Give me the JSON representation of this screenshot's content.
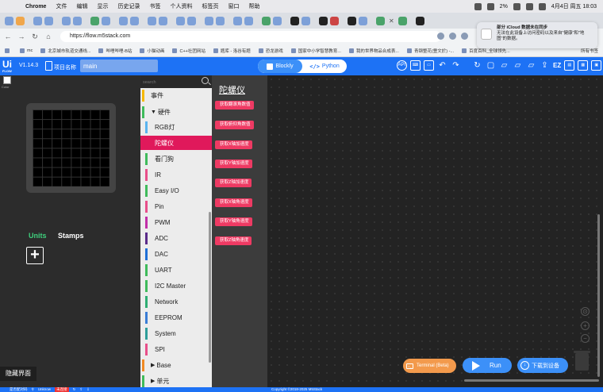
{
  "menubar": {
    "app": "Chrome",
    "items": [
      "文件",
      "编辑",
      "显示",
      "历史记录",
      "书签",
      "个人资料",
      "标签页",
      "窗口",
      "帮助"
    ],
    "battery": "2%",
    "datetime": "4月4日 周五 18:03"
  },
  "browser": {
    "url": "https://flow.m5stack.com",
    "bookmarks": [
      "",
      "mc",
      "北京城市轨道交通线...",
      "哔哩哔哩-B站",
      "小猫动画",
      "C++社团网站",
      "题库 - 洛谷有题",
      "恐龙游戏",
      "国家中小学智慧教育...",
      "我的世界物品合成表...",
      "青钢整花(豊文於) -...",
      "百度百科_全球领先..."
    ],
    "all_bookmarks": "所有书签"
  },
  "notification": {
    "title": "部分 iCloud 数据未在同步",
    "body": "无法在此设备上访问密码以及来自\"健康\"和\"地图\"的数据。"
  },
  "header": {
    "logo": "Ui",
    "logo_sub": "FLOW",
    "version": "V1.14.3",
    "project_label": "项目名称",
    "project_name": "main",
    "mode_blockly": "Blockly",
    "mode_python": "Python",
    "ez_label": "EZ"
  },
  "device": {
    "color_label": "Color",
    "units_tab": "Units",
    "stamps_tab": "Stamps",
    "hide_ui": "隐藏界面"
  },
  "category": {
    "search_placeholder": "search",
    "items": [
      {
        "label": "事件",
        "color": "#f5b800",
        "sub": false
      },
      {
        "label": "硬件",
        "color": "#3fbb5b",
        "sub": false,
        "expanded": true
      },
      {
        "label": "RGB灯",
        "color": "#5ab4f0",
        "sub": true
      },
      {
        "label": "陀螺仪",
        "color": "#e0195b",
        "sub": true,
        "selected": true
      },
      {
        "label": "看门狗",
        "color": "#3fbb5b",
        "sub": true
      },
      {
        "label": "IR",
        "color": "#e84f8a",
        "sub": true
      },
      {
        "label": "Easy I/O",
        "color": "#3fbb5b",
        "sub": true
      },
      {
        "label": "Pin",
        "color": "#e84f8a",
        "sub": true
      },
      {
        "label": "PWM",
        "color": "#c12fa8",
        "sub": true
      },
      {
        "label": "ADC",
        "color": "#5a2b8a",
        "sub": true
      },
      {
        "label": "DAC",
        "color": "#1f6fd6",
        "sub": true
      },
      {
        "label": "UART",
        "color": "#3fbb5b",
        "sub": true
      },
      {
        "label": "I2C Master",
        "color": "#3fbb5b",
        "sub": true
      },
      {
        "label": "Network",
        "color": "#2fae73",
        "sub": true
      },
      {
        "label": "EEPROM",
        "color": "#3a7dd6",
        "sub": true
      },
      {
        "label": "System",
        "color": "#2e9e9a",
        "sub": true
      },
      {
        "label": "SPI",
        "color": "#e84f8a",
        "sub": true
      },
      {
        "label": "Base",
        "color": "#f08a24",
        "sub": false
      },
      {
        "label": "单元",
        "color": "#3fbb5b",
        "sub": false
      }
    ]
  },
  "flyout": {
    "title": "陀螺仪",
    "blocks": [
      "获取翻滚角数值",
      "获取俯仰角数值",
      "获取X轴加速度",
      "获取Y轴加速度",
      "获取Z轴加速度",
      "获取X轴角速度",
      "获取Y轴角速度",
      "获取Z轴角速度"
    ]
  },
  "actions": {
    "terminal": "Terminal (Beta)",
    "run": "Run",
    "download": "下载到设备"
  },
  "status": {
    "item1": "是否配对码",
    "item2": "Unknow",
    "item3": "未连接",
    "copyright": "Copyright ©2018-2025 M5Stack"
  }
}
